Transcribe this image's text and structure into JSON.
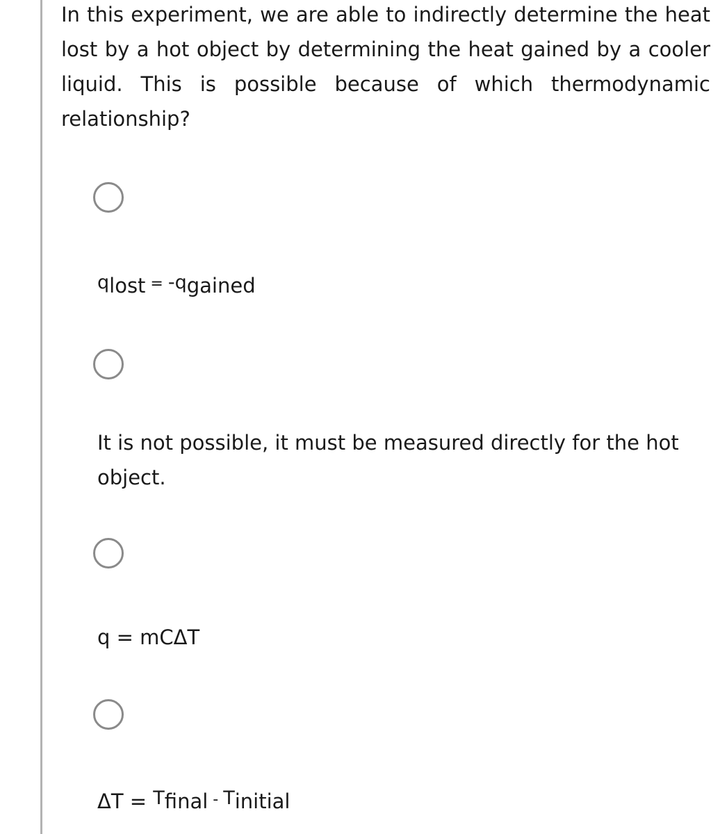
{
  "question": {
    "text": "In this experiment, we are able to indirectly determine the heat lost by a hot object by determining the heat gained by a cooler liquid. This is possible because of which thermodynamic relationship?"
  },
  "options": [
    {
      "q1": "q",
      "sub1": "lost",
      "eq": " = ",
      "neg": "-",
      "q2": "q",
      "sub2": "gained",
      "selected": false
    },
    {
      "text": "It is not possible, it must be measured directly for the hot object.",
      "selected": false
    },
    {
      "text": "q = mCΔT",
      "selected": false
    },
    {
      "prefix": "ΔT = ",
      "t1": "T",
      "sub1": "final",
      "minus": " - ",
      "t2": "T",
      "sub2": "initial",
      "selected": false
    }
  ]
}
